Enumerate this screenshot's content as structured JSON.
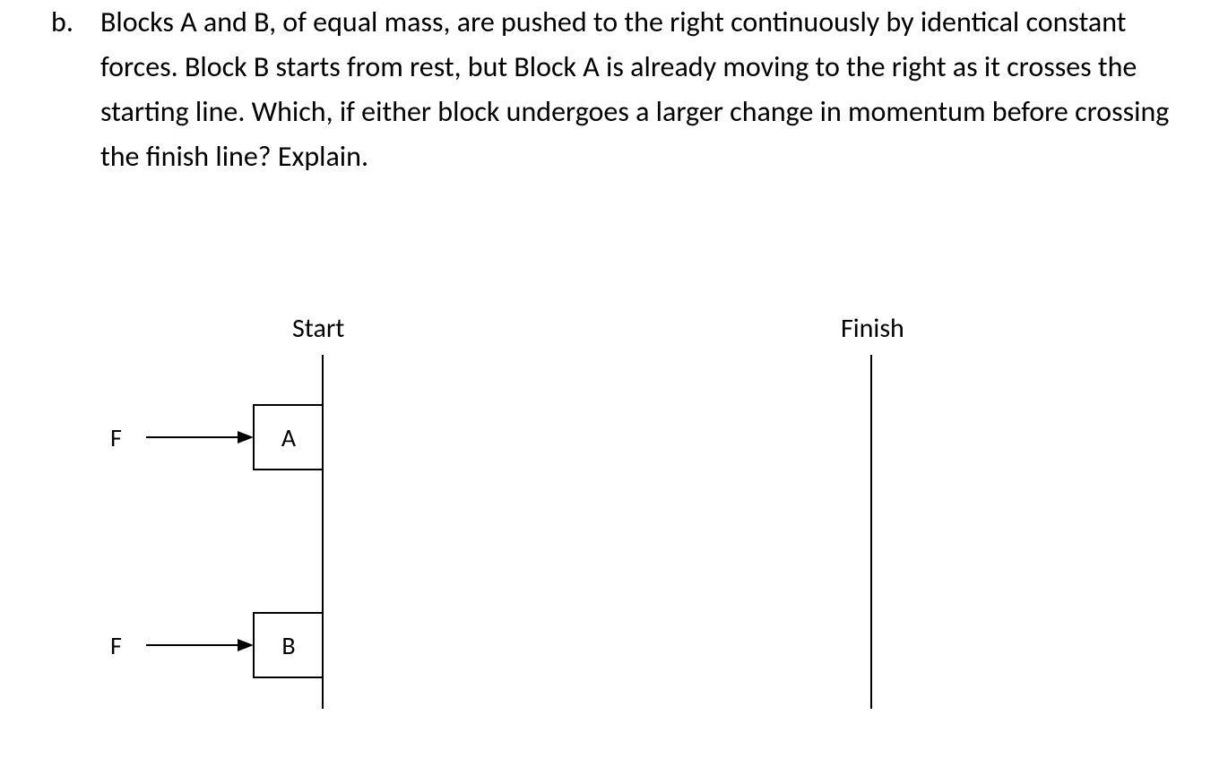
{
  "question": {
    "marker": "b.",
    "text": "Blocks A and B, of equal mass, are pushed to the right continuously by identical constant forces. Block B starts from rest, but Block A is already moving to the right as it crosses the starting line. Which, if either block undergoes a larger change in momentum before crossing the finish line? Explain."
  },
  "diagram": {
    "start_label": "Start",
    "finish_label": "Finish",
    "block_a_label": "A",
    "block_b_label": "B",
    "force_a_label": "F",
    "force_b_label": "F"
  }
}
